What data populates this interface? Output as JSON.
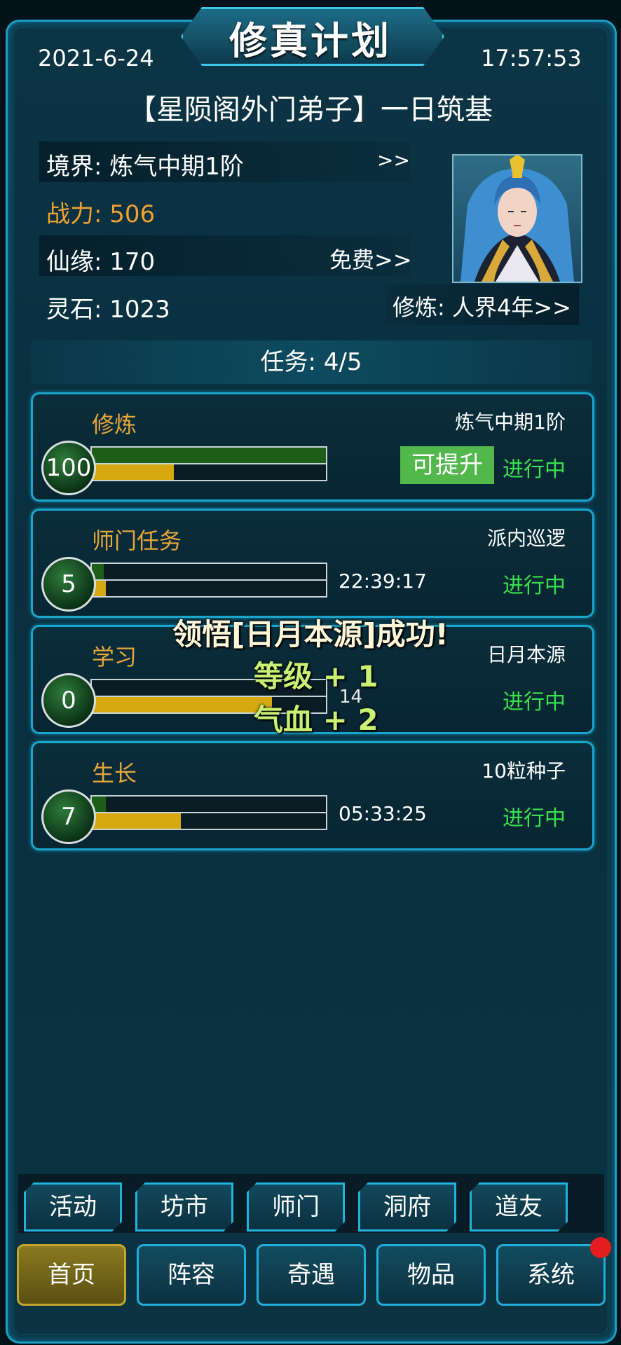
{
  "header": {
    "title": "修真计划",
    "date": "2021-6-24",
    "time": "17:57:53",
    "subtitle": "【星陨阁外门弟子】一日筑基"
  },
  "stats": {
    "realm": "境界: 炼气中期1阶",
    "realm_link": ">>",
    "power": "战力: 506",
    "fate": "仙缘: 170",
    "fate_link": "免费>>",
    "stones": "灵石: 1023",
    "cultivation": "修炼: 人界4年>>"
  },
  "tasks_header": "任务: 4/5",
  "tasks": [
    {
      "name": "修炼",
      "sub": "炼气中期1阶",
      "level": "100",
      "info": "",
      "action": "可提升",
      "status": "进行中",
      "progress_top": 1.0,
      "progress_bottom": 0.35
    },
    {
      "name": "师门任务",
      "sub": "派内巡逻",
      "level": "5",
      "info": "22:39:17",
      "action": "",
      "status": "进行中",
      "progress_top": 0.05,
      "progress_bottom": 0.06
    },
    {
      "name": "学习",
      "sub": "日月本源",
      "level": "0",
      "info": "14",
      "action": "",
      "status": "进行中",
      "progress_top": 0.0,
      "progress_bottom": 0.77
    },
    {
      "name": "生长",
      "sub": "10粒种子",
      "level": "7",
      "info": "05:33:25",
      "action": "",
      "status": "进行中",
      "progress_top": 0.06,
      "progress_bottom": 0.38
    }
  ],
  "popup": {
    "title": "领悟[日月本源]成功!",
    "line1": "等级 + 1",
    "line2": "气血 + 2"
  },
  "menu": [
    "活动",
    "坊市",
    "师门",
    "洞府",
    "道友"
  ],
  "nav": [
    "首页",
    "阵容",
    "奇遇",
    "物品",
    "系统"
  ],
  "colors": {
    "accent": "#1b9fc4",
    "status": "#38e24a",
    "gold": "#e8a53a",
    "power": "#f0a030"
  }
}
